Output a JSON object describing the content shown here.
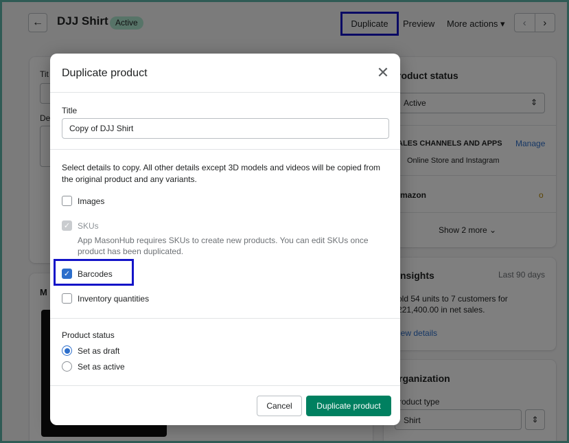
{
  "header": {
    "back_icon": "arrow-left-icon",
    "title": "DJJ Shirt",
    "status_badge": "Active",
    "duplicate_label": "Duplicate",
    "preview_label": "Preview",
    "more_actions_label": "More actions",
    "prev_icon": "chevron-left-icon",
    "next_icon": "chevron-right-icon"
  },
  "background_left": {
    "title_fragment": "Tit",
    "desc_fragment": "De",
    "media_fragment": "M"
  },
  "background_right": {
    "product_status_title": "roduct status",
    "status_value": "Active",
    "channels_title": "ALES CHANNELS AND APPS",
    "manage_label": "Manage",
    "channel_online": "Online Store and Instagram",
    "amazon": "mazon",
    "show_more": "Show 2 more",
    "insights_title": "nsights",
    "insights_period": "Last 90 days",
    "insights_line1": "old 54 units to 7 customers for",
    "insights_line2": "221,400.00 in net sales.",
    "view_details": "iew details",
    "organization_title": "rganization",
    "product_type_label": "roduct type",
    "product_type_value": "Shirt"
  },
  "modal": {
    "title": "Duplicate product",
    "close_icon": "close-icon",
    "title_label": "Title",
    "title_value": "Copy of DJJ Shirt",
    "description": "Select details to copy. All other details except 3D models and videos will be copied from the original product and any variants.",
    "options": {
      "images": {
        "label": "Images",
        "checked": false
      },
      "skus": {
        "label": "SKUs",
        "checked": true,
        "disabled": true,
        "help": "App MasonHub requires SKUs to create new products. You can edit SKUs once product has been duplicated."
      },
      "barcodes": {
        "label": "Barcodes",
        "checked": true
      },
      "inventory": {
        "label": "Inventory quantities",
        "checked": false
      }
    },
    "status_label": "Product status",
    "status_options": [
      {
        "label": "Set as draft",
        "selected": true
      },
      {
        "label": "Set as active",
        "selected": false
      }
    ],
    "cancel_label": "Cancel",
    "confirm_label": "Duplicate product"
  },
  "colors": {
    "primary": "#008060",
    "checkbox": "#2c6ecb",
    "highlight": "#1414c8",
    "badge": "#aee9d1"
  }
}
